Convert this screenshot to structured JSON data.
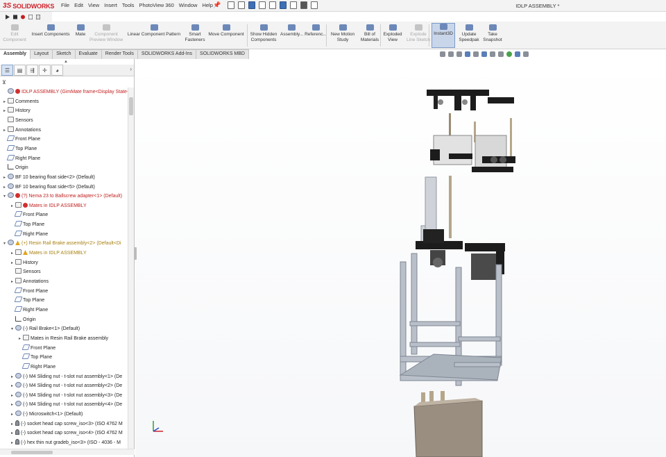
{
  "app": {
    "logo_ds": "3S",
    "logo_name": "SOLIDWORKS",
    "document_title": "IDLP ASSEMBLY *"
  },
  "menu": [
    "File",
    "Edit",
    "View",
    "Insert",
    "Tools",
    "PhotoView 360",
    "Window",
    "Help"
  ],
  "commands": [
    {
      "label": "Edit\nComponent",
      "disabled": true
    },
    {
      "label": "Insert Components",
      "disabled": false
    },
    {
      "label": "Mate",
      "disabled": false
    },
    {
      "label": "Component\nPreview Window",
      "disabled": true
    },
    {
      "label": "Linear Component Pattern",
      "disabled": false
    },
    {
      "label": "Smart\nFasteners",
      "disabled": false
    },
    {
      "label": "Move Component",
      "disabled": false
    },
    {
      "label": "Show Hidden\nComponents",
      "disabled": false
    },
    {
      "label": "Assembly...",
      "disabled": false
    },
    {
      "label": "Referenc...",
      "disabled": false
    },
    {
      "label": "New Motion\nStudy",
      "disabled": false
    },
    {
      "label": "Bill of\nMaterials",
      "disabled": false
    },
    {
      "label": "Exploded\nView",
      "disabled": false
    },
    {
      "label": "Explode\nLine Sketch",
      "disabled": true
    },
    {
      "label": "Instant3D",
      "disabled": false,
      "active": true
    },
    {
      "label": "Update\nSpeedpak",
      "disabled": false
    },
    {
      "label": "Take\nSnapshot",
      "disabled": false
    }
  ],
  "tabs": [
    "Assembly",
    "Layout",
    "Sketch",
    "Evaluate",
    "Render Tools",
    "SOLIDWORKS Add-Ins",
    "SOLIDWORKS MBD"
  ],
  "active_tab": "Assembly",
  "tree": [
    {
      "label": "IDLP ASSEMBLY  (GimMate frame<Display State-1>)",
      "indent": 0,
      "icon": "comp",
      "marker": "err",
      "twist": ""
    },
    {
      "label": "Comments",
      "indent": 0,
      "icon": "fold",
      "twist": "▸"
    },
    {
      "label": "History",
      "indent": 0,
      "icon": "fold",
      "twist": "▸"
    },
    {
      "label": "Sensors",
      "indent": 0,
      "icon": "fold",
      "twist": ""
    },
    {
      "label": "Annotations",
      "indent": 0,
      "icon": "fold",
      "twist": "▸"
    },
    {
      "label": "Front Plane",
      "indent": 0,
      "icon": "plane",
      "twist": ""
    },
    {
      "label": "Top Plane",
      "indent": 0,
      "icon": "plane",
      "twist": ""
    },
    {
      "label": "Right Plane",
      "indent": 0,
      "icon": "plane",
      "twist": ""
    },
    {
      "label": "Origin",
      "indent": 0,
      "icon": "origin",
      "twist": ""
    },
    {
      "label": "BF 10 bearing float side<2> (Default)",
      "indent": 0,
      "icon": "comp",
      "twist": "▸"
    },
    {
      "label": "BF 10 bearing float side<5> (Default)",
      "indent": 0,
      "icon": "comp",
      "twist": "▸"
    },
    {
      "label": "(?) Nema 23 to Ballscrew adapter<1> (Default)",
      "indent": 0,
      "icon": "comp",
      "marker": "err",
      "twist": "▾"
    },
    {
      "label": "Mates in IDLP ASSEMBLY",
      "indent": 1,
      "icon": "fold",
      "marker": "err",
      "twist": "▸"
    },
    {
      "label": "Front Plane",
      "indent": 1,
      "icon": "plane",
      "twist": ""
    },
    {
      "label": "Top Plane",
      "indent": 1,
      "icon": "plane",
      "twist": ""
    },
    {
      "label": "Right Plane",
      "indent": 1,
      "icon": "plane",
      "twist": ""
    },
    {
      "label": "(+) Resin Rail Brake assembly<2> (Default<Di",
      "indent": 0,
      "icon": "comp",
      "marker": "warn",
      "twist": "▾"
    },
    {
      "label": "Mates in IDLP ASSEMBLY",
      "indent": 1,
      "icon": "fold",
      "marker": "warn",
      "twist": "▸"
    },
    {
      "label": "History",
      "indent": 1,
      "icon": "fold",
      "twist": "▸"
    },
    {
      "label": "Sensors",
      "indent": 1,
      "icon": "fold",
      "twist": ""
    },
    {
      "label": "Annotations",
      "indent": 1,
      "icon": "fold",
      "twist": "▸"
    },
    {
      "label": "Front Plane",
      "indent": 1,
      "icon": "plane",
      "twist": ""
    },
    {
      "label": "Top Plane",
      "indent": 1,
      "icon": "plane",
      "twist": ""
    },
    {
      "label": "Right Plane",
      "indent": 1,
      "icon": "plane",
      "twist": ""
    },
    {
      "label": "Origin",
      "indent": 1,
      "icon": "origin",
      "twist": ""
    },
    {
      "label": "(-) Rail Brake<1> (Default)",
      "indent": 1,
      "icon": "comp",
      "twist": "▾"
    },
    {
      "label": "Mates in Resin Rail Brake assembly",
      "indent": 2,
      "icon": "fold",
      "twist": "▸"
    },
    {
      "label": "Front Plane",
      "indent": 2,
      "icon": "plane",
      "twist": ""
    },
    {
      "label": "Top Plane",
      "indent": 2,
      "icon": "plane",
      "twist": ""
    },
    {
      "label": "Right Plane",
      "indent": 2,
      "icon": "plane",
      "twist": ""
    },
    {
      "label": "(-) M4 Sliding nut - t-slot nut assembly<1> (De",
      "indent": 1,
      "icon": "comp",
      "twist": "▸"
    },
    {
      "label": "(-) M4 Sliding nut - t-slot nut assembly<2> (De",
      "indent": 1,
      "icon": "comp",
      "twist": "▸"
    },
    {
      "label": "(-) M4 Sliding nut - t-slot nut assembly<3> (De",
      "indent": 1,
      "icon": "comp",
      "twist": "▸"
    },
    {
      "label": "(-) M4 Sliding nut - t-slot nut assembly<4> (De",
      "indent": 1,
      "icon": "comp",
      "twist": "▸"
    },
    {
      "label": "(-) Microswitch<1> (Default)",
      "indent": 1,
      "icon": "comp",
      "twist": "▸"
    },
    {
      "label": "(-) socket head cap screw_iso<3> (ISO 4762 M",
      "indent": 1,
      "icon": "screw",
      "twist": "▸"
    },
    {
      "label": "(-) socket head cap screw_iso<4> (ISO 4762 M",
      "indent": 1,
      "icon": "screw",
      "twist": "▸"
    },
    {
      "label": "(-) hex thin nut gradeb_iso<3> (ISO - 4036 - M",
      "indent": 1,
      "icon": "screw",
      "twist": "▸"
    }
  ],
  "colors": {
    "brand": "#d0202a",
    "error": "#c22020",
    "warning": "#a88010",
    "frame": "#9aa3ae",
    "bracket": "#1a1a1a"
  }
}
